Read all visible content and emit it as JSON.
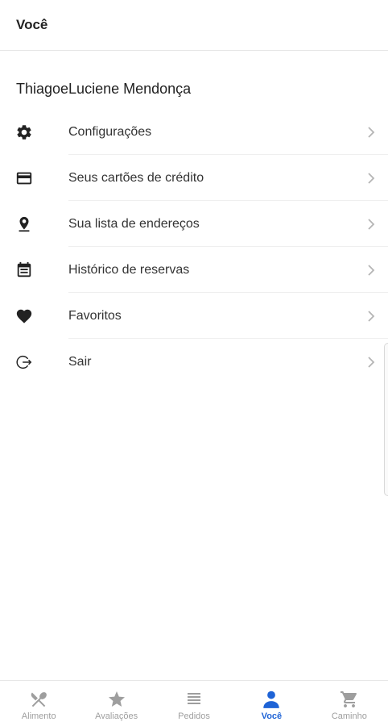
{
  "header": {
    "title": "Você"
  },
  "user": {
    "name": "ThiagoeLuciene Mendonça"
  },
  "menu": {
    "items": [
      {
        "label": "Configurações",
        "icon": "gear-icon"
      },
      {
        "label": "Seus cartões de crédito",
        "icon": "credit-card-icon"
      },
      {
        "label": "Sua lista de endereços",
        "icon": "map-pin-icon"
      },
      {
        "label": "Histórico de reservas",
        "icon": "calendar-list-icon"
      },
      {
        "label": "Favoritos",
        "icon": "heart-icon"
      },
      {
        "label": "Sair",
        "icon": "logout-icon"
      }
    ]
  },
  "bottom_nav": {
    "items": [
      {
        "label": "Alimento",
        "icon": "fork-knife-icon"
      },
      {
        "label": "Avaliações",
        "icon": "star-icon"
      },
      {
        "label": "Pedidos",
        "icon": "list-icon"
      },
      {
        "label": "Você",
        "icon": "user-icon",
        "active": true
      },
      {
        "label": "Caminho",
        "icon": "cart-icon"
      }
    ]
  },
  "colors": {
    "accent": "#1e63d6",
    "inactive": "#9e9e9e",
    "icon": "#222222"
  }
}
